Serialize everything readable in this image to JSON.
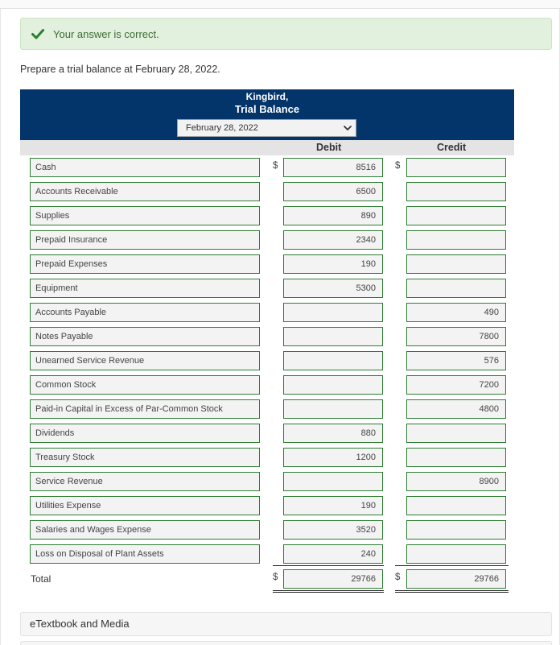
{
  "alert": {
    "message": "Your answer is correct.",
    "color": "#3c6b32",
    "icon": "check-icon"
  },
  "instruction": "Prepare a trial balance at February 28, 2022.",
  "header": {
    "company": "Kingbird,",
    "title": "Trial Balance",
    "date_selected": "February 28, 2022",
    "background": "#03346a"
  },
  "columns": {
    "debit": "Debit",
    "credit": "Credit"
  },
  "currency_symbol": "$",
  "rows": [
    {
      "account": "Cash",
      "debit": "8516",
      "credit": ""
    },
    {
      "account": "Accounts Receivable",
      "debit": "6500",
      "credit": ""
    },
    {
      "account": "Supplies",
      "debit": "890",
      "credit": ""
    },
    {
      "account": "Prepaid Insurance",
      "debit": "2340",
      "credit": ""
    },
    {
      "account": "Prepaid Expenses",
      "debit": "190",
      "credit": ""
    },
    {
      "account": "Equipment",
      "debit": "5300",
      "credit": ""
    },
    {
      "account": "Accounts Payable",
      "debit": "",
      "credit": "490"
    },
    {
      "account": "Notes Payable",
      "debit": "",
      "credit": "7800"
    },
    {
      "account": "Unearned Service Revenue",
      "debit": "",
      "credit": "576"
    },
    {
      "account": "Common Stock",
      "debit": "",
      "credit": "7200"
    },
    {
      "account": "Paid-in Capital in Excess of Par-Common Stock",
      "debit": "",
      "credit": "4800"
    },
    {
      "account": "Dividends",
      "debit": "880",
      "credit": ""
    },
    {
      "account": "Treasury Stock",
      "debit": "1200",
      "credit": ""
    },
    {
      "account": "Service Revenue",
      "debit": "",
      "credit": "8900"
    },
    {
      "account": "Utilities Expense",
      "debit": "190",
      "credit": ""
    },
    {
      "account": "Salaries and Wages Expense",
      "debit": "3520",
      "credit": ""
    },
    {
      "account": "Loss on Disposal of Plant Assets",
      "debit": "240",
      "credit": ""
    }
  ],
  "total": {
    "label": "Total",
    "debit": "29766",
    "credit": "29766"
  },
  "footer": {
    "etextbook": "eTextbook and Media"
  }
}
